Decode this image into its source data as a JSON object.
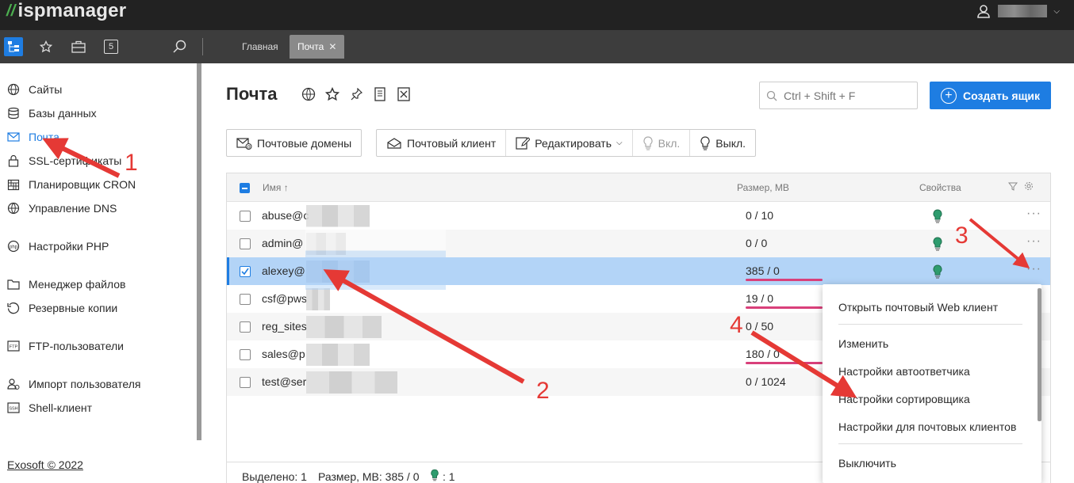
{
  "app": {
    "logo": "ispmanager",
    "user_icon": "user-icon"
  },
  "toolbar": {
    "icons": [
      "tree-icon",
      "star-icon",
      "briefcase-icon",
      "number-5-icon",
      "search-icon"
    ],
    "badge": "5",
    "tabs": [
      {
        "label": "Главная",
        "active": false
      },
      {
        "label": "Почта",
        "active": true,
        "close": "✕"
      }
    ]
  },
  "sidebar": {
    "items": [
      {
        "label": "Сайты",
        "icon": "globe-icon"
      },
      {
        "label": "Базы данных",
        "icon": "database-icon"
      },
      {
        "label": "Почта",
        "icon": "mail-icon",
        "active": true
      },
      {
        "label": "SSL-сертификаты",
        "icon": "lock-icon"
      },
      {
        "label": "Планировщик CRON",
        "icon": "calendar-icon"
      },
      {
        "label": "Управление DNS",
        "icon": "dns-icon"
      },
      {
        "label": "Настройки PHP",
        "icon": "php-icon"
      },
      {
        "label": "Менеджер файлов",
        "icon": "folder-icon"
      },
      {
        "label": "Резервные копии",
        "icon": "backup-icon"
      },
      {
        "label": "FTP-пользователи",
        "icon": "ftp-icon"
      },
      {
        "label": "Импорт пользователя",
        "icon": "import-user-icon"
      },
      {
        "label": "Shell-клиент",
        "icon": "ssh-icon"
      }
    ],
    "footer": "Exosoft © 2022"
  },
  "main": {
    "title": "Почта",
    "search": {
      "placeholder": "Ctrl + Shift + F"
    },
    "create_button": "Создать ящик",
    "actions": {
      "domains": "Почтовые домены",
      "client": "Почтовый клиент",
      "edit": "Редактировать",
      "on": "Вкл.",
      "off": "Выкл."
    },
    "table": {
      "headers": {
        "name": "Имя",
        "sort_arrow": "↑",
        "size": "Размер, МВ",
        "props": "Свойства"
      },
      "rows": [
        {
          "name": "abuse@c",
          "size": "0 / 10",
          "selected": false,
          "underline": false
        },
        {
          "name": "admin@",
          "size": "0 / 0",
          "selected": false,
          "underline": false
        },
        {
          "name": "alexey@",
          "size": "385 / 0",
          "selected": true,
          "underline": true
        },
        {
          "name": "csf@pws",
          "size": "19 / 0",
          "selected": false,
          "underline": true
        },
        {
          "name": "reg_sites",
          "size": "0 / 50",
          "selected": false,
          "underline": false
        },
        {
          "name": "sales@p",
          "size": "180 / 0",
          "selected": false,
          "underline": true
        },
        {
          "name": "test@ser",
          "size": "0 / 1024",
          "selected": false,
          "underline": false
        }
      ]
    },
    "status": {
      "selected": "Выделено: 1",
      "size": "Размер, МВ: 385 / 0",
      "bulb_count": ": 1"
    },
    "context_menu": {
      "items": [
        "Открыть почтовый Web клиент",
        "Изменить",
        "Настройки автоответчика",
        "Настройки сортировщика",
        "Настройки для почтовых клиентов",
        "Выключить"
      ]
    }
  },
  "annotations": [
    "1",
    "2",
    "3",
    "4"
  ],
  "colors": {
    "accent": "#1e7de2",
    "arrow": "#e53935",
    "underline": "#d9407a",
    "bulb": "#2e9c6e"
  }
}
